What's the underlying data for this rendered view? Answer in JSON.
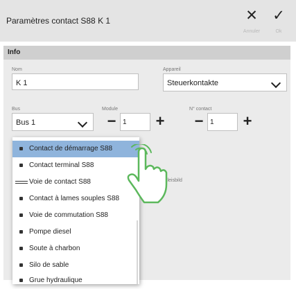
{
  "window": {
    "title": "Paramètres contact S88 K 1",
    "cancel": {
      "icon": "close-icon",
      "glyph": "✕",
      "label": "Annuler"
    },
    "ok": {
      "icon": "check-icon",
      "glyph": "✓",
      "label": "Ok"
    }
  },
  "info": {
    "heading": "Info",
    "name": {
      "label": "Nom",
      "value": "K 1"
    },
    "device": {
      "label": "Appareil",
      "value": "Steuerkontakte"
    },
    "bus": {
      "label": "Bus",
      "value": "Bus 1"
    },
    "module": {
      "label": "Module",
      "value": "1",
      "minus": "−",
      "plus": "+"
    },
    "contact_no": {
      "label": "N° contact",
      "value": "1",
      "minus": "−",
      "plus": "+"
    },
    "track_label": "Gleisbild"
  },
  "type_list": {
    "items": [
      {
        "label": "Contact de démarrage S88",
        "icon": "start-contact-icon",
        "selected": true
      },
      {
        "label": "Contact terminal S88",
        "icon": "terminal-contact-icon"
      },
      {
        "label": "Voie de contact S88",
        "icon": "contact-track-icon"
      },
      {
        "label": "Contact à lames souples S88",
        "icon": "reed-contact-icon"
      },
      {
        "label": "Voie de commutation S88",
        "icon": "switching-track-icon"
      },
      {
        "label": "Pompe diesel",
        "icon": "diesel-pump-icon"
      },
      {
        "label": "Soute à charbon",
        "icon": "coal-bunker-icon"
      },
      {
        "label": "Silo de sable",
        "icon": "sand-silo-icon"
      },
      {
        "label": "Grue hydraulique",
        "icon": "water-crane-icon"
      }
    ]
  },
  "colors": {
    "selected_row": "#8fb4dc",
    "titlebar": "#e4e4e4",
    "section_head": "#cfcfcf"
  }
}
